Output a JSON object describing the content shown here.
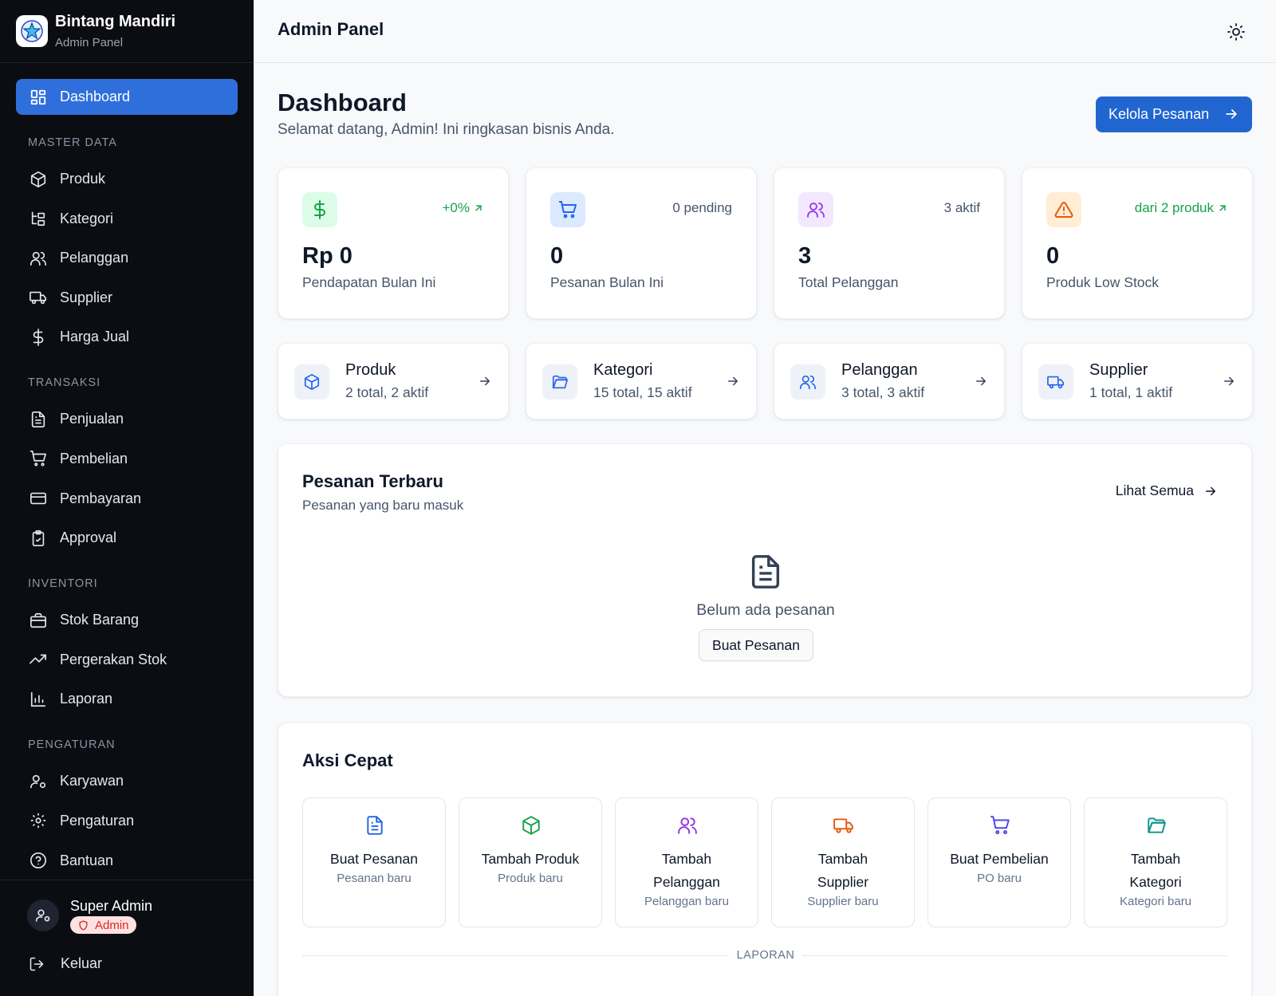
{
  "brand": {
    "name": "Bintang Mandiri",
    "subtitle": "Admin Panel"
  },
  "sidebar": {
    "active": {
      "label": "Dashboard",
      "icon": "dashboard-icon"
    },
    "sections": [
      {
        "title": "MASTER DATA",
        "items": [
          {
            "label": "Produk",
            "icon": "box-icon"
          },
          {
            "label": "Kategori",
            "icon": "category-tree-icon"
          },
          {
            "label": "Pelanggan",
            "icon": "users-icon"
          },
          {
            "label": "Supplier",
            "icon": "truck-icon"
          },
          {
            "label": "Harga Jual",
            "icon": "dollar-icon"
          }
        ]
      },
      {
        "title": "TRANSAKSI",
        "items": [
          {
            "label": "Penjualan",
            "icon": "document-icon"
          },
          {
            "label": "Pembelian",
            "icon": "cart-icon"
          },
          {
            "label": "Pembayaran",
            "icon": "credit-card-icon"
          },
          {
            "label": "Approval",
            "icon": "clipboard-check-icon"
          }
        ]
      },
      {
        "title": "INVENTORI",
        "items": [
          {
            "label": "Stok Barang",
            "icon": "briefcase-icon"
          },
          {
            "label": "Pergerakan Stok",
            "icon": "trending-up-icon"
          },
          {
            "label": "Laporan",
            "icon": "bar-chart-icon"
          }
        ]
      },
      {
        "title": "PENGATURAN",
        "items": [
          {
            "label": "Karyawan",
            "icon": "user-cog-icon"
          },
          {
            "label": "Pengaturan",
            "icon": "gear-icon"
          },
          {
            "label": "Bantuan",
            "icon": "help-circle-icon"
          }
        ]
      }
    ],
    "user": {
      "name": "Super Admin",
      "role": "Admin"
    },
    "logout_label": "Keluar"
  },
  "header": {
    "title": "Admin Panel",
    "theme_icon": "sun-icon"
  },
  "page": {
    "title": "Dashboard",
    "subtitle": "Selamat datang, Admin! Ini ringkasan bisnis Anda.",
    "primary_action": "Kelola Pesanan"
  },
  "stats": [
    {
      "value": "Rp 0",
      "label": "Pendapatan Bulan Ini",
      "tag": "+0%",
      "icon": "dollar-icon",
      "color": "#16a34a",
      "bg": "#dcfce7"
    },
    {
      "value": "0",
      "label": "Pesanan Bulan Ini",
      "tag": "0 pending",
      "icon": "cart-icon",
      "color": "#2563eb",
      "bg": "#dbeafe"
    },
    {
      "value": "3",
      "label": "Total Pelanggan",
      "tag": "3 aktif",
      "icon": "users-icon",
      "color": "#9333ea",
      "bg": "#f3e8ff"
    },
    {
      "value": "0",
      "label": "Produk Low Stock",
      "tag": "dari 2 produk",
      "icon": "alert-triangle-icon",
      "color": "#ea580c",
      "bg": "#ffedd5"
    }
  ],
  "links": [
    {
      "title": "Produk",
      "sub": "2 total, 2 aktif",
      "icon": "box-icon"
    },
    {
      "title": "Kategori",
      "sub": "15 total, 15 aktif",
      "icon": "folder-icon"
    },
    {
      "title": "Pelanggan",
      "sub": "3 total, 3 aktif",
      "icon": "users-icon"
    },
    {
      "title": "Supplier",
      "sub": "1 total, 1 aktif",
      "icon": "truck-icon"
    }
  ],
  "orders": {
    "title": "Pesanan Terbaru",
    "subtitle": "Pesanan yang baru masuk",
    "see_all": "Lihat Semua",
    "empty_text": "Belum ada pesanan",
    "empty_action": "Buat Pesanan"
  },
  "quick_actions": {
    "title": "Aksi Cepat",
    "items": [
      {
        "title": "Buat Pesanan",
        "sub": "Pesanan baru",
        "icon": "document-icon",
        "color": "#2563eb"
      },
      {
        "title": "Tambah Produk",
        "sub": "Produk baru",
        "icon": "box-icon",
        "color": "#16a34a"
      },
      {
        "title": "Tambah Pelanggan",
        "sub": "Pelanggan baru",
        "icon": "users-icon",
        "color": "#9333ea"
      },
      {
        "title": "Tambah Supplier",
        "sub": "Supplier baru",
        "icon": "truck-icon",
        "color": "#ea580c"
      },
      {
        "title": "Buat Pembelian",
        "sub": "PO baru",
        "icon": "cart-icon",
        "color": "#4f46e5"
      },
      {
        "title": "Tambah Kategori",
        "sub": "Kategori baru",
        "icon": "folder-icon",
        "color": "#0d9488"
      }
    ],
    "divider_label": "LAPORAN"
  }
}
